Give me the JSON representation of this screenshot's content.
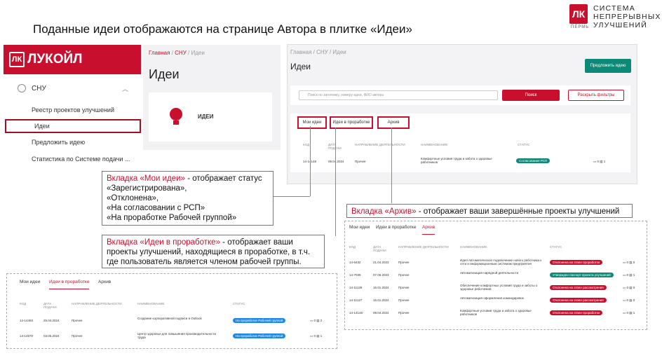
{
  "title": "Поданные идеи отображаются на странице Автора в плитке «Идеи»",
  "brand": {
    "logo": "ЛК",
    "sub": "ПЕРМЬ",
    "line1": "СИСТЕМА",
    "line2": "НЕПРЕРЫВНЫХ",
    "line3": "УЛУЧШЕНИЙ"
  },
  "sidebar": {
    "brand": "ЛУКОЙЛ",
    "section": "СНУ",
    "items": [
      "Реестр проектов улучшений",
      "Идеи",
      "Предложить идею",
      "Статистика по Системе подачи ..."
    ]
  },
  "ideas_panel": {
    "breadcrumb": [
      "Главная",
      "/",
      "СНУ",
      "/",
      "Идеи"
    ],
    "heading": "Идеи",
    "tile": "ИДЕИ"
  },
  "screen": {
    "breadcrumb": "Главная / СНУ / Идеи",
    "heading": "Идеи",
    "submit": "Предложить идею",
    "search_placeholder": "Поиск по заголовку, номеру идеи, ФИО автора",
    "search_button": "Поиск",
    "filters": "Раскрыть фильтры",
    "tabs": [
      "Мои идеи",
      "Идеи в проработке",
      "Архив"
    ],
    "columns": [
      "КОД",
      "ДАТА ПОДАЧИ",
      "НАПРАВЛЕНИЕ ДЕЯТЕЛЬНОСТИ",
      "НАИМЕНОВАНИЕ",
      "СТАТУС"
    ],
    "row": {
      "code": "14-14148",
      "date": "09.04.2024",
      "dir": "Прочее",
      "name": "Комфортные условия труда и забота о здоровье работников",
      "status": "Согласование РСП",
      "c1": "0",
      "c2": "1"
    }
  },
  "callouts": {
    "my_ideas": {
      "label": "Вкладка «Мои идеи»",
      "text": " - отображает статус",
      "lines": [
        "«Зарегистрирована»,",
        "«Отклонена»,",
        "«На согласовании с РСП»",
        "«На проработке Рабочей группой»"
      ]
    },
    "in_work": {
      "label": "Вкладка «Идеи в проработке»",
      "text": " - отображает ваши",
      "lines": [
        "проекты улучшений, находящиеся в проработке, в т.ч.",
        "где пользователь является членом рабочей группы."
      ]
    },
    "archive": {
      "label": "Вкладка «Архив»",
      "text": " - отображает ваши завершённые проекты улучшений"
    }
  },
  "archive_screen": {
    "tabs": [
      "Мои идеи",
      "Идеи в проработке",
      "Архив"
    ],
    "columns": [
      "КОД",
      "ДАТА ПОДАЧИ",
      "НАПРАВЛЕНИЕ ДЕЯТЕЛЬНОСТИ",
      "НАИМЕНОВАНИЕ",
      "СТАТУС"
    ],
    "rows": [
      {
        "code": "14-6432",
        "date": "21.04.2023",
        "dir": "Прочее",
        "name": "Идея Автоматическое подключение нового работника к сети и информационным системам предприятия",
        "status": "Отклонена на этапе проработки",
        "c1": "0",
        "c2": "0"
      },
      {
        "code": "14-7035",
        "date": "07.06.2023",
        "dir": "Прочее",
        "name": "Автоматизация нарядной деятельности",
        "status": "Утвержден паспорт проекта улучшений",
        "c1": "0",
        "c2": "1"
      },
      {
        "code": "14-11128",
        "date": "16.01.2024",
        "dir": "Прочее",
        "name": "Обеспечение комфортных условий труда и заботы о здоровье работников",
        "status": "Отклонена на этапе рассмотрения",
        "c1": "0",
        "c2": "0"
      },
      {
        "code": "14-11127",
        "date": "16.01.2024",
        "dir": "Прочее",
        "name": "Автоматизация оформления командировок",
        "status": "Отклонена на этапе рассмотрения",
        "c1": "0",
        "c2": "0"
      },
      {
        "code": "14-14148",
        "date": "09.04.2024",
        "dir": "Прочее",
        "name": "Комфортные условия труда и забота о здоровье работников",
        "status": "Отклонена на этапе проработки",
        "c1": "0",
        "c2": "1"
      }
    ]
  },
  "inwork_screen": {
    "tabs": [
      "Мои идеи",
      "Идеи в проработке",
      "Архив"
    ],
    "columns": [
      "КОД",
      "ДАТА ПОДАЧИ",
      "НАПРАВЛЕНИЕ ДЕЯТЕЛЬНОСТИ",
      "НАИМЕНОВАНИЕ",
      "СТАТУС"
    ],
    "rows": [
      {
        "code": "14-14493",
        "date": "25.04.2024",
        "dir": "Прочее",
        "name": "Создание корпоративной подписи в Outlook",
        "status": "На проработке Рабочей группой",
        "c1": "0",
        "c2": "2"
      },
      {
        "code": "14-14570",
        "date": "03.05.2024",
        "dir": "Прочее",
        "name": "Центр здоровья для повышения производительности труда",
        "status": "На проработке Рабочей группой",
        "c1": "0",
        "c2": "1"
      }
    ]
  },
  "colors": {
    "brand_red": "#c8102e",
    "teal": "#0d8a77",
    "blue": "#1e88e5"
  }
}
